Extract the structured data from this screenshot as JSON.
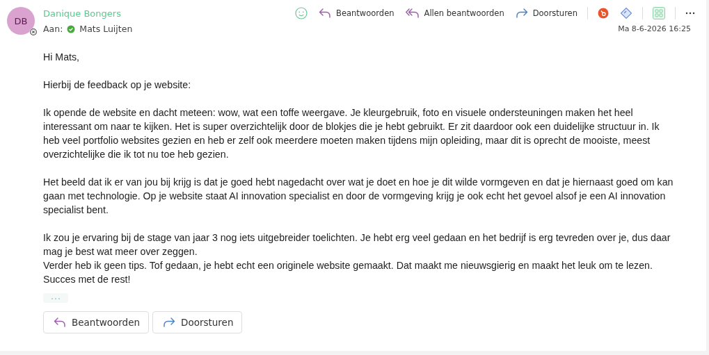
{
  "sender": {
    "initials": "DB",
    "name": "Danique Bongers",
    "to_label": "Aan:",
    "recipient": "Mats Luijten"
  },
  "toolbar": [
    {
      "kind": "emoji"
    },
    {
      "kind": "reply",
      "label": "Beantwoorden"
    },
    {
      "kind": "reply_all",
      "label": "Allen beantwoorden"
    },
    {
      "kind": "forward",
      "label": "Doorsturen"
    },
    {
      "kind": "divider"
    },
    {
      "kind": "app_orange"
    },
    {
      "kind": "app_diamond"
    },
    {
      "kind": "divider"
    },
    {
      "kind": "apps"
    },
    {
      "kind": "divider"
    },
    {
      "kind": "more"
    }
  ],
  "date": "Ma 8-6-2026 16:25",
  "body": [
    {
      "lines": [
        "Hi Mats,"
      ]
    },
    {
      "lines": [
        "Hierbij de feedback op je website:"
      ]
    },
    {
      "lines": [
        "Ik opende de website en dacht meteen: wow, wat een toffe weergave. Je kleurgebruik, foto en visuele ondersteuningen maken het heel interessant om naar te kijken. Het is super overzichtelijk door de blokjes die je hebt gebruikt. Er zit daardoor ook een duidelijke structuur in. Ik heb veel portfolio websites gezien en heb er zelf ook meerdere moeten maken tijdens mijn opleiding, maar dit is oprecht de mooiste, meest overzichtelijke die ik tot nu toe heb gezien."
      ]
    },
    {
      "lines": [
        "Het beeld dat ik er van jou bij krijg is dat je goed hebt nagedacht over wat je doet en hoe je dit wilde vormgeven en dat je hiernaast goed om kan gaan met technologie. Op je website staat AI innovation specialist en door de vormgeving krijg je ook echt het gevoel alsof je een AI innovation specialist bent."
      ]
    },
    {
      "lines": [
        "Ik zou je ervaring bij de stage van jaar 3 nog iets uitgebreider toelichten. Je hebt erg veel gedaan en het bedrijf is erg tevreden over je, dus daar mag je best wat meer over zeggen.",
        "Verder heb ik geen tips. Tof gedaan, je hebt echt een originele website gemaakt. Dat maakt me nieuwsgierig en maakt het leuk om te lezen. Succes met de rest!"
      ]
    }
  ],
  "footer_buttons": [
    {
      "kind": "reply",
      "label": "Beantwoorden"
    },
    {
      "kind": "forward",
      "label": "Doorsturen"
    }
  ]
}
